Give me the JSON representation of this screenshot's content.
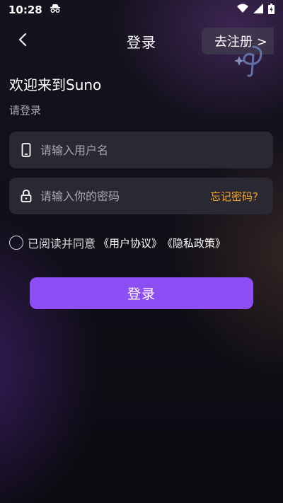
{
  "status_bar": {
    "time": "10:28"
  },
  "nav": {
    "title": "登录",
    "register_label": "去注册 >"
  },
  "welcome": "欢迎来到Suno",
  "subtitle": "请登录",
  "username": {
    "placeholder": "请输入用户名",
    "value": ""
  },
  "password": {
    "placeholder": "请输入你的密码",
    "value": "",
    "forgot_label": "忘记密码?"
  },
  "agreement": {
    "prefix": "已阅读并同意",
    "user_agreement": "《用户协议》",
    "privacy_policy": "《隐私政策》",
    "checked": false
  },
  "login_button": "登录",
  "colors": {
    "accent": "#8d4ef5",
    "forgot": "#f4a623",
    "field_bg": "#2a2933"
  }
}
